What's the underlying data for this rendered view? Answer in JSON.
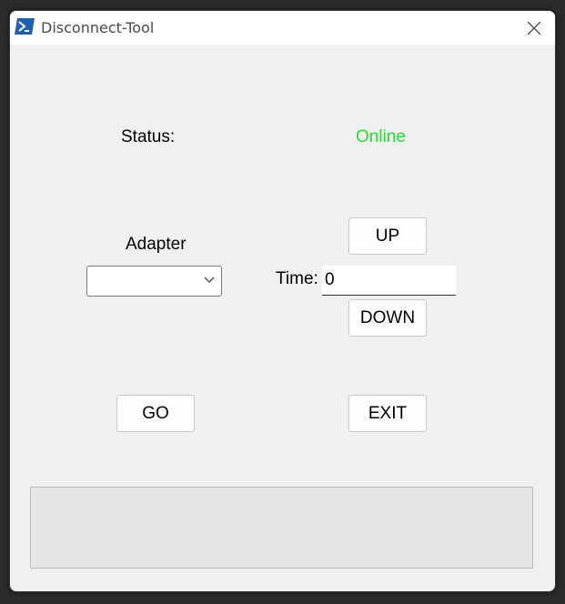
{
  "window": {
    "title": "Disconnect-Tool"
  },
  "status": {
    "label": "Status:",
    "value": "Online",
    "value_color": "#22e02a"
  },
  "adapter": {
    "label": "Adapter",
    "selected": ""
  },
  "time": {
    "label": "Time:",
    "value": "0"
  },
  "buttons": {
    "up": "UP",
    "down": "DOWN",
    "go": "GO",
    "exit": "EXIT"
  },
  "log": {
    "text": ""
  }
}
